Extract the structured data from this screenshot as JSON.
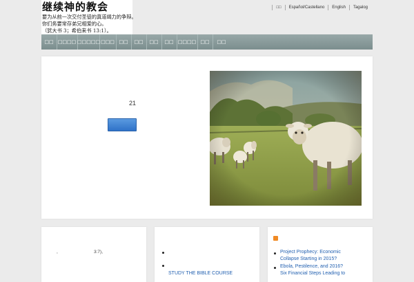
{
  "site": {
    "title": "继续神的教会",
    "tagline": [
      "要为从前一次交付圣徒的真道竭力的争辩。",
      "你们务要常存弟兄相爱的心。",
      "（犹大书 3；希伯来书 13:1）。"
    ]
  },
  "top_nav": [
    "□□",
    "Español/Castellano",
    "English",
    "Tagalog"
  ],
  "menu": [
    "□□",
    "□□□□",
    "□□□□□",
    "□□□",
    "□□",
    "□□",
    "□□",
    "□□",
    "□□□□",
    "□□",
    "□□"
  ],
  "slider": {
    "count": "21"
  },
  "cards": {
    "left_text": [
      ",",
      "3:7),"
    ],
    "middle_link": "STUDY THE BIBLE COURSE",
    "right_links": [
      "Project Prophecy: Economic",
      "Collapse Starting in 2015?",
      "Ebola, Pestilence, and 2016?",
      "Six Financial Steps Leading to"
    ]
  }
}
